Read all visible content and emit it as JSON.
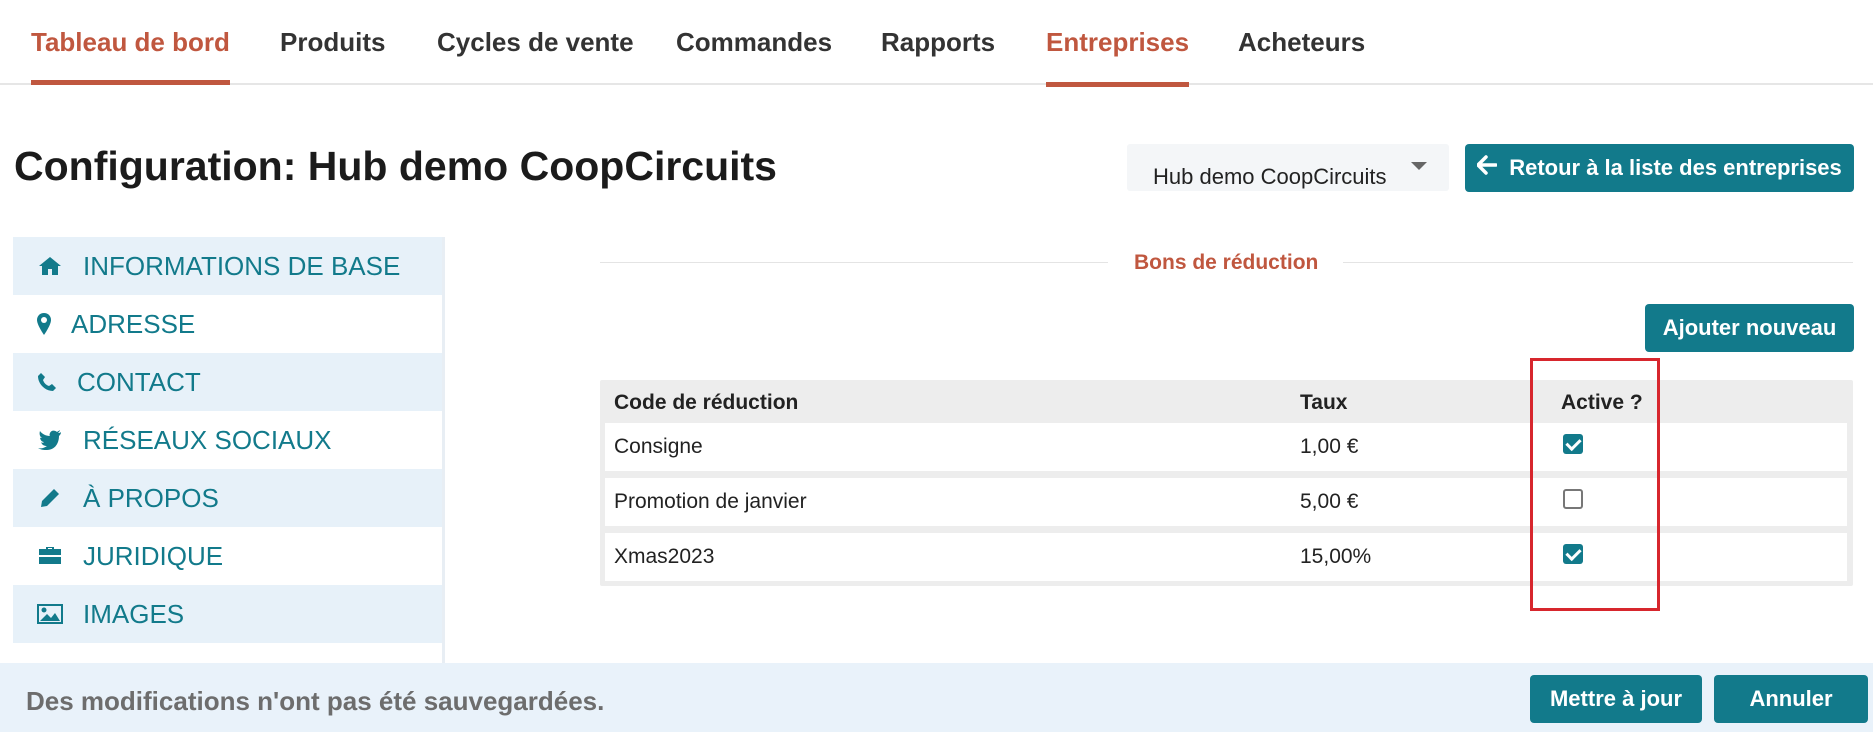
{
  "nav": {
    "items": [
      {
        "label": "Tableau de bord"
      },
      {
        "label": "Produits"
      },
      {
        "label": "Cycles de vente"
      },
      {
        "label": "Commandes"
      },
      {
        "label": "Rapports"
      },
      {
        "label": "Entreprises"
      },
      {
        "label": "Acheteurs"
      }
    ]
  },
  "header": {
    "title": "Configuration: Hub demo CoopCircuits",
    "enterprise_select": "Hub demo CoopCircuits",
    "back_button": "Retour à la liste des entreprises"
  },
  "sidebar": {
    "items": [
      {
        "label": "INFORMATIONS DE BASE",
        "icon": "home-icon"
      },
      {
        "label": "ADRESSE",
        "icon": "map-marker-icon"
      },
      {
        "label": "CONTACT",
        "icon": "phone-icon"
      },
      {
        "label": "RÉSEAUX SOCIAUX",
        "icon": "twitter-icon"
      },
      {
        "label": "À PROPOS",
        "icon": "pencil-icon"
      },
      {
        "label": "JURIDIQUE",
        "icon": "briefcase-icon"
      },
      {
        "label": "IMAGES",
        "icon": "image-icon"
      }
    ]
  },
  "section": {
    "title": "Bons de réduction",
    "add_button": "Ajouter nouveau"
  },
  "table": {
    "headers": [
      "Code de réduction",
      "Taux",
      "Active ?"
    ],
    "rows": [
      {
        "code": "Consigne",
        "rate": "1,00 €",
        "active": true
      },
      {
        "code": "Promotion de janvier",
        "rate": "5,00 €",
        "active": false
      },
      {
        "code": "Xmas2023",
        "rate": "15,00%",
        "active": true
      }
    ]
  },
  "footer": {
    "unsaved_message": "Des modifications n'ont pas été sauvegardées.",
    "update_button": "Mettre à jour",
    "cancel_button": "Annuler"
  },
  "colors": {
    "accent": "#127a8b",
    "active_nav": "#c0573f",
    "highlight_box": "#d7262d"
  }
}
